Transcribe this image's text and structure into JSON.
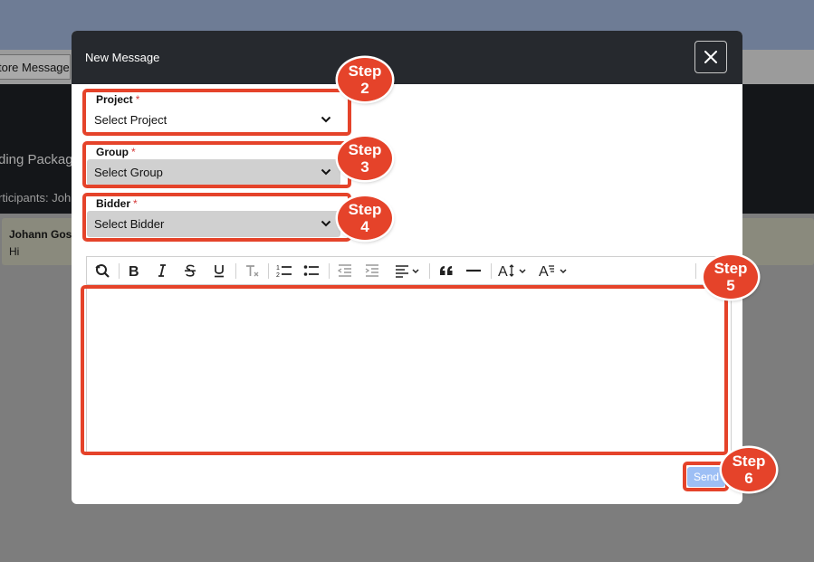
{
  "background": {
    "tab_label": "tore Message",
    "package_title": "ding Packag",
    "participants_text": "rticipants: Joh",
    "message": {
      "author": "Johann Gos",
      "text": "Hi"
    }
  },
  "modal": {
    "title": "New Message",
    "close_icon": "close-icon",
    "fields": {
      "project": {
        "label": "Project",
        "required_mark": "*",
        "value": "Select Project"
      },
      "group": {
        "label": "Group",
        "required_mark": "*",
        "value": "Select Group"
      },
      "bidder": {
        "label": "Bidder",
        "required_mark": "*",
        "value": "Select Bidder"
      }
    },
    "toolbar_icons": [
      "find-replace-icon",
      "bold-icon",
      "italic-icon",
      "strikethrough-icon",
      "underline-icon",
      "clear-format-icon",
      "numbered-list-icon",
      "bullet-list-icon",
      "outdent-icon",
      "indent-icon",
      "align-icon",
      "blockquote-icon",
      "horizontal-rule-icon",
      "font-size-icon",
      "font-family-icon"
    ],
    "editor_value": "",
    "send_label": "Send"
  },
  "annotations": {
    "step2": {
      "word": "Step",
      "number": "2"
    },
    "step3": {
      "word": "Step",
      "number": "3"
    },
    "step4": {
      "word": "Step",
      "number": "4"
    },
    "step5": {
      "word": "Step",
      "number": "5"
    },
    "step6": {
      "word": "Step",
      "number": "6"
    }
  },
  "colors": {
    "annotation_red": "#e5432a",
    "modal_header": "#26292e",
    "send_button": "#9dbff5",
    "required_asterisk": "#d63a3a"
  }
}
